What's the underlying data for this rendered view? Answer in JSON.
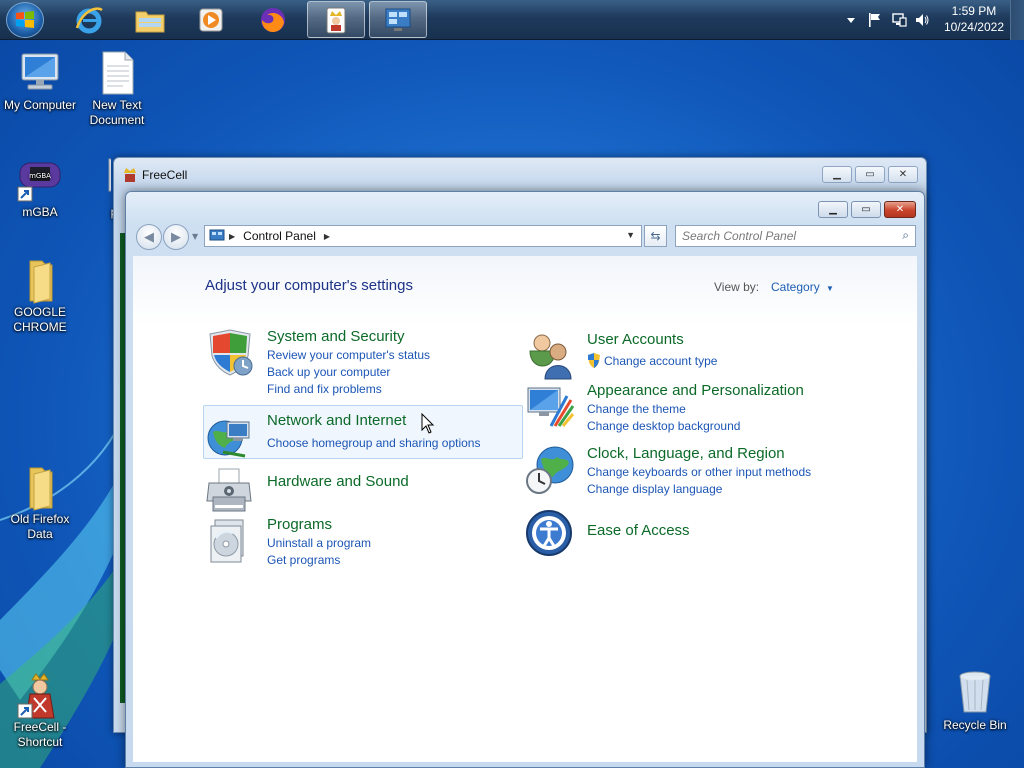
{
  "taskbar": {
    "clock_time": "1:59 PM",
    "clock_date": "10/24/2022",
    "pinned": [
      {
        "name": "internet-explorer-icon"
      },
      {
        "name": "file-explorer-icon"
      },
      {
        "name": "media-player-icon"
      },
      {
        "name": "firefox-icon"
      },
      {
        "name": "freecell-icon"
      },
      {
        "name": "control-panel-icon"
      }
    ]
  },
  "desktop": {
    "icons": [
      {
        "label": "My Computer",
        "icon": "computer-icon"
      },
      {
        "label": "New Text Document",
        "icon": "text-file-icon"
      },
      {
        "label": "mGBA",
        "icon": "gameboy-icon"
      },
      {
        "label": "pi",
        "icon": "settings-icon"
      },
      {
        "label": "GOOGLE CHROME",
        "icon": "folder-icon"
      },
      {
        "label": "Old Firefox Data",
        "icon": "folder-icon"
      },
      {
        "label": "FreeCell - Shortcut",
        "icon": "freecell-king-icon"
      },
      {
        "label": "Recycle Bin",
        "icon": "recycle-bin-icon"
      }
    ]
  },
  "freecell_window": {
    "title": "FreeCell"
  },
  "control_panel": {
    "breadcrumb": "Control Panel",
    "search_placeholder": "Search Control Panel",
    "heading": "Adjust your computer's settings",
    "view_by_label": "View by:",
    "view_by_value": "Category",
    "categories": [
      {
        "title": "System and Security",
        "icon": "shield-icon",
        "links": [
          "Review your computer's status",
          "Back up your computer",
          "Find and fix problems"
        ]
      },
      {
        "title": "Network and Internet",
        "icon": "globe-network-icon",
        "links": [
          "Choose homegroup and sharing options"
        ]
      },
      {
        "title": "Hardware and Sound",
        "icon": "printer-icon",
        "links": []
      },
      {
        "title": "Programs",
        "icon": "programs-icon",
        "links": [
          "Uninstall a program",
          "Get programs"
        ]
      },
      {
        "title": "User Accounts",
        "icon": "users-icon",
        "links": [
          "Change account type"
        ]
      },
      {
        "title": "Appearance and Personalization",
        "icon": "display-icon",
        "links": [
          "Change the theme",
          "Change desktop background"
        ]
      },
      {
        "title": "Clock, Language, and Region",
        "icon": "clock-globe-icon",
        "links": [
          "Change keyboards or other input methods",
          "Change display language"
        ]
      },
      {
        "title": "Ease of Access",
        "icon": "accessibility-icon",
        "links": []
      }
    ]
  }
}
